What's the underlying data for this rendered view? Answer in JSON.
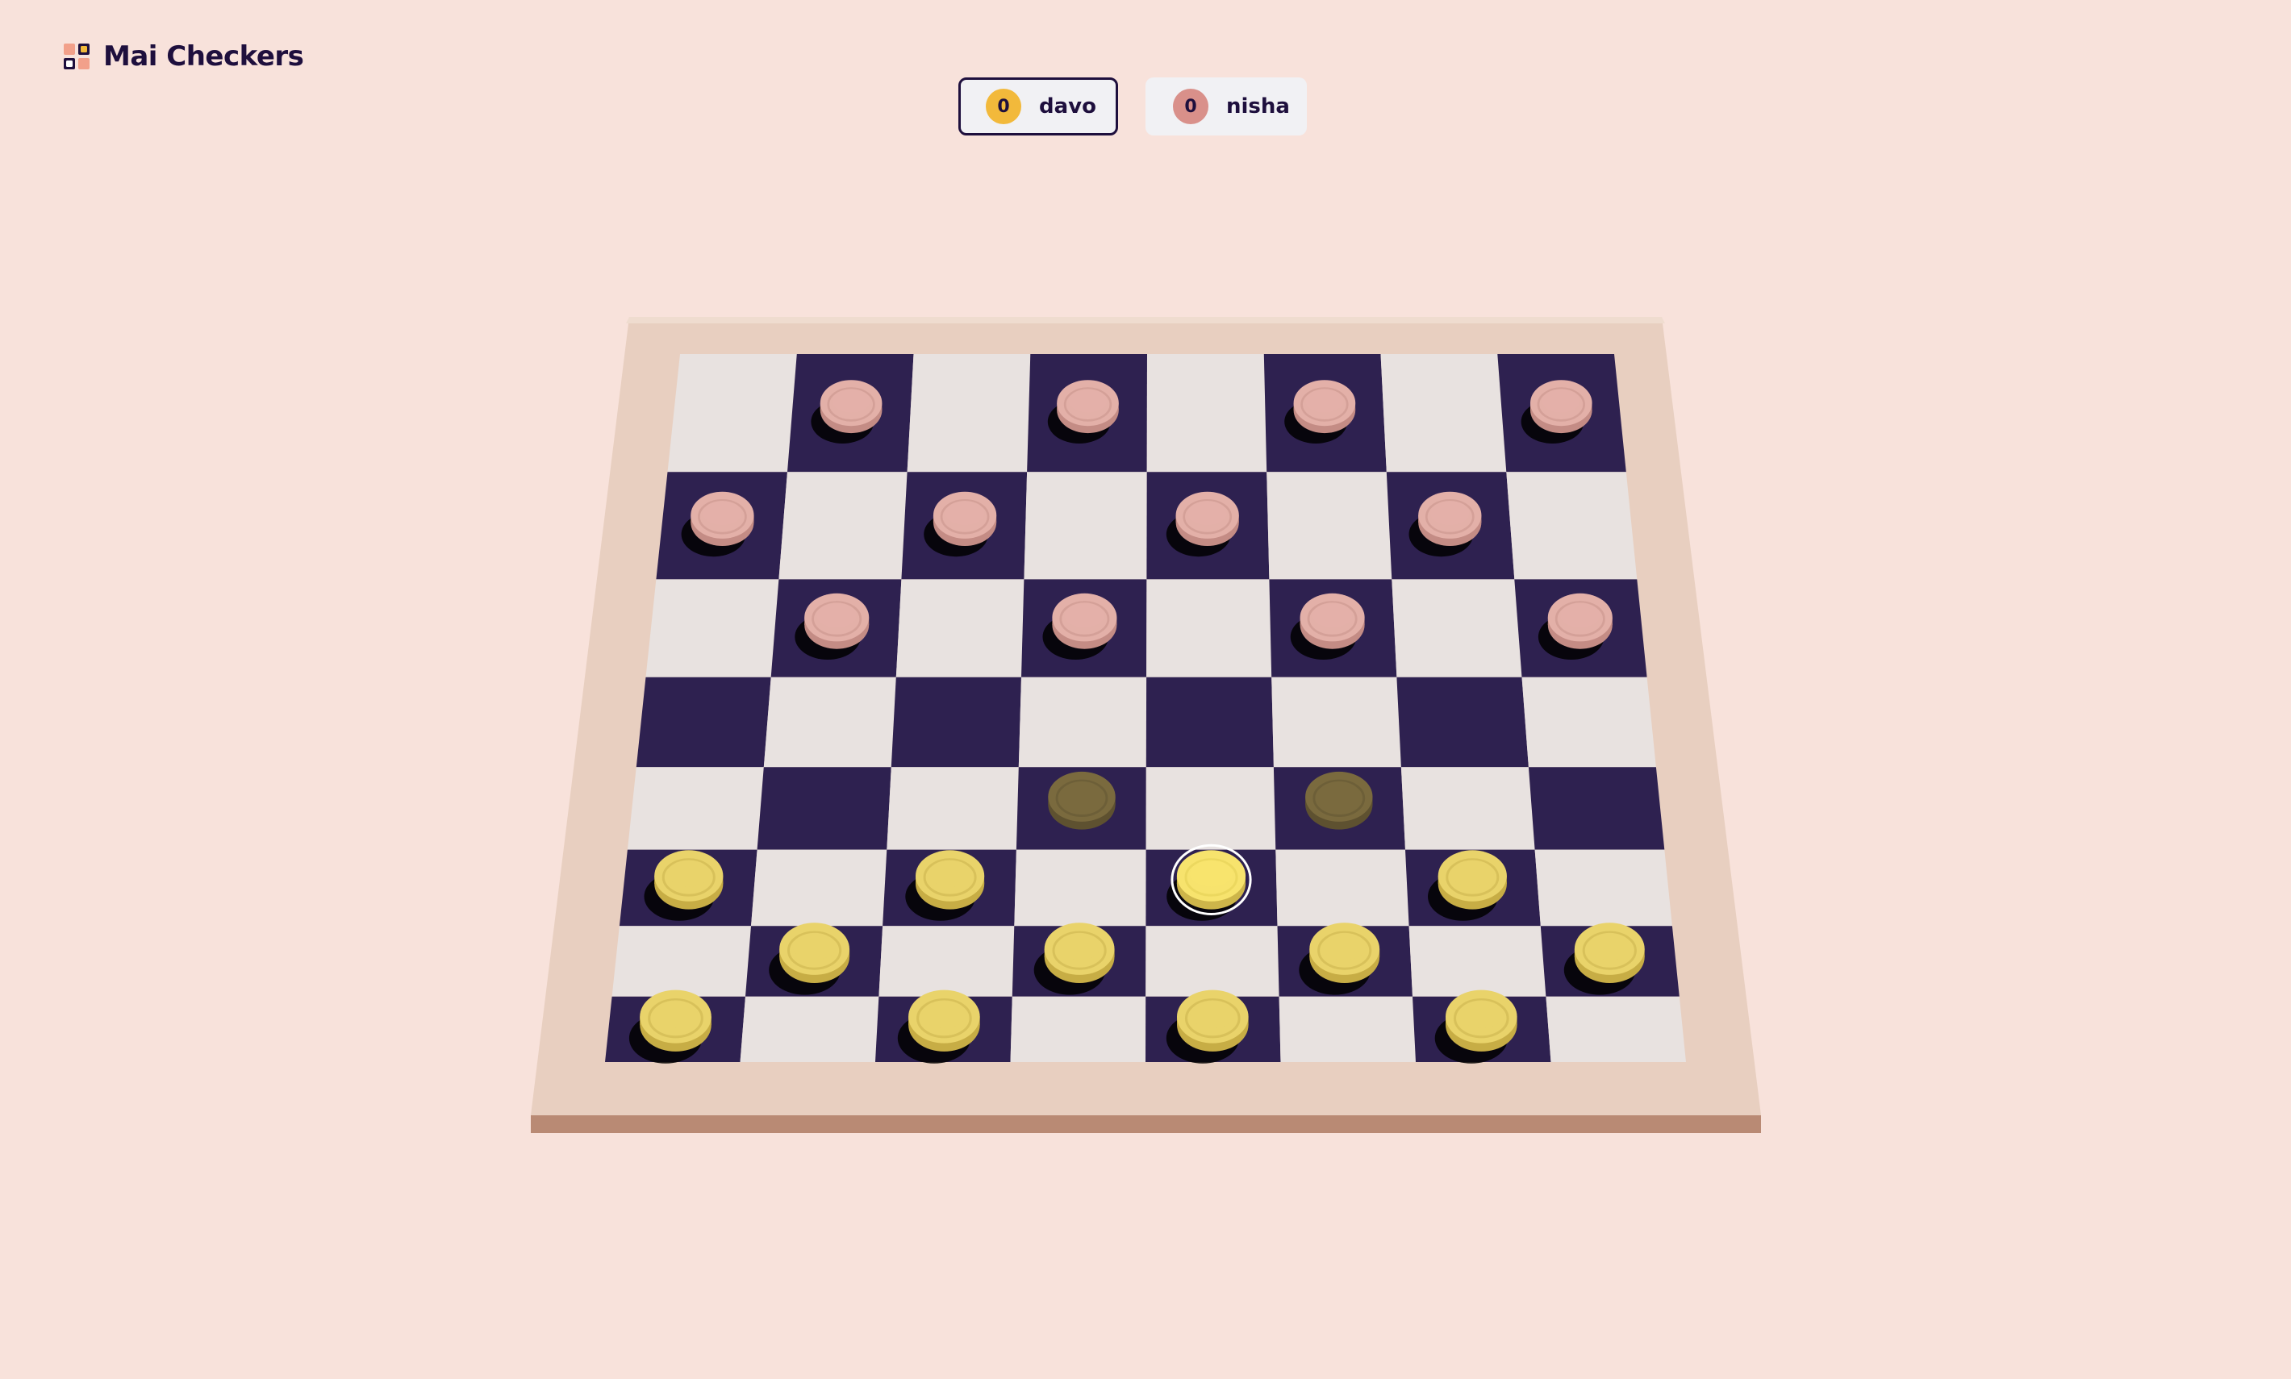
{
  "app": {
    "title": "Mai Checkers",
    "logo_icon": "checkers-logo-icon"
  },
  "players": [
    {
      "name": "davo",
      "score": "0",
      "color": "#f2b93b",
      "active": true
    },
    {
      "name": "nisha",
      "score": "0",
      "color": "#d9908a",
      "active": false
    }
  ],
  "colors": {
    "background": "#f8e2db",
    "frame": "#e8cfc0",
    "frame_edge": "#b98a74",
    "dark_square": "#2e2150",
    "light_square": "#e8e2e0",
    "pink_piece": "#e3b0a8",
    "yellow_piece": "#e9d36a",
    "selected_piece": "#f7e36d",
    "move_hint": "#7a6a3e"
  },
  "board": {
    "rows": [
      [
        "",
        "P",
        "",
        "P",
        "",
        "P",
        "",
        "P"
      ],
      [
        "P",
        "",
        "P",
        "",
        "P",
        "",
        "P",
        ""
      ],
      [
        "",
        "P",
        "",
        "P",
        "",
        "P",
        "",
        "P"
      ],
      [
        "",
        "",
        "",
        "",
        "",
        "",
        "",
        ""
      ],
      [
        "",
        "",
        "",
        "H",
        "",
        "H",
        "",
        ""
      ],
      [
        "Y",
        "",
        "Y",
        "",
        "S",
        "",
        "Y",
        ""
      ],
      [
        "",
        "Y",
        "",
        "Y",
        "",
        "Y",
        "",
        "Y"
      ],
      [
        "Y",
        "",
        "Y",
        "",
        "Y",
        "",
        "Y",
        ""
      ]
    ],
    "legend": {
      "P": "pink-piece",
      "Y": "yellow-piece",
      "S": "selected-yellow-piece",
      "H": "move-hint"
    }
  }
}
